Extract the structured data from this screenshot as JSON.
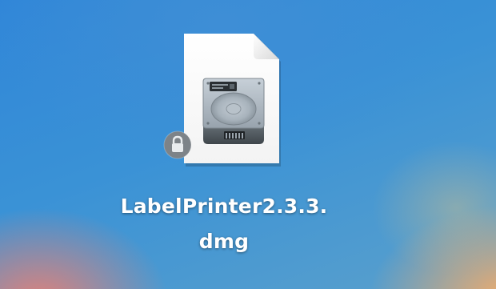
{
  "desktop": {
    "file": {
      "name_line1": "LabelPrinter2.3.3.",
      "name_line2": "dmg",
      "icon": "disk-image-document-icon",
      "badge_icon": "lock-icon"
    }
  }
}
